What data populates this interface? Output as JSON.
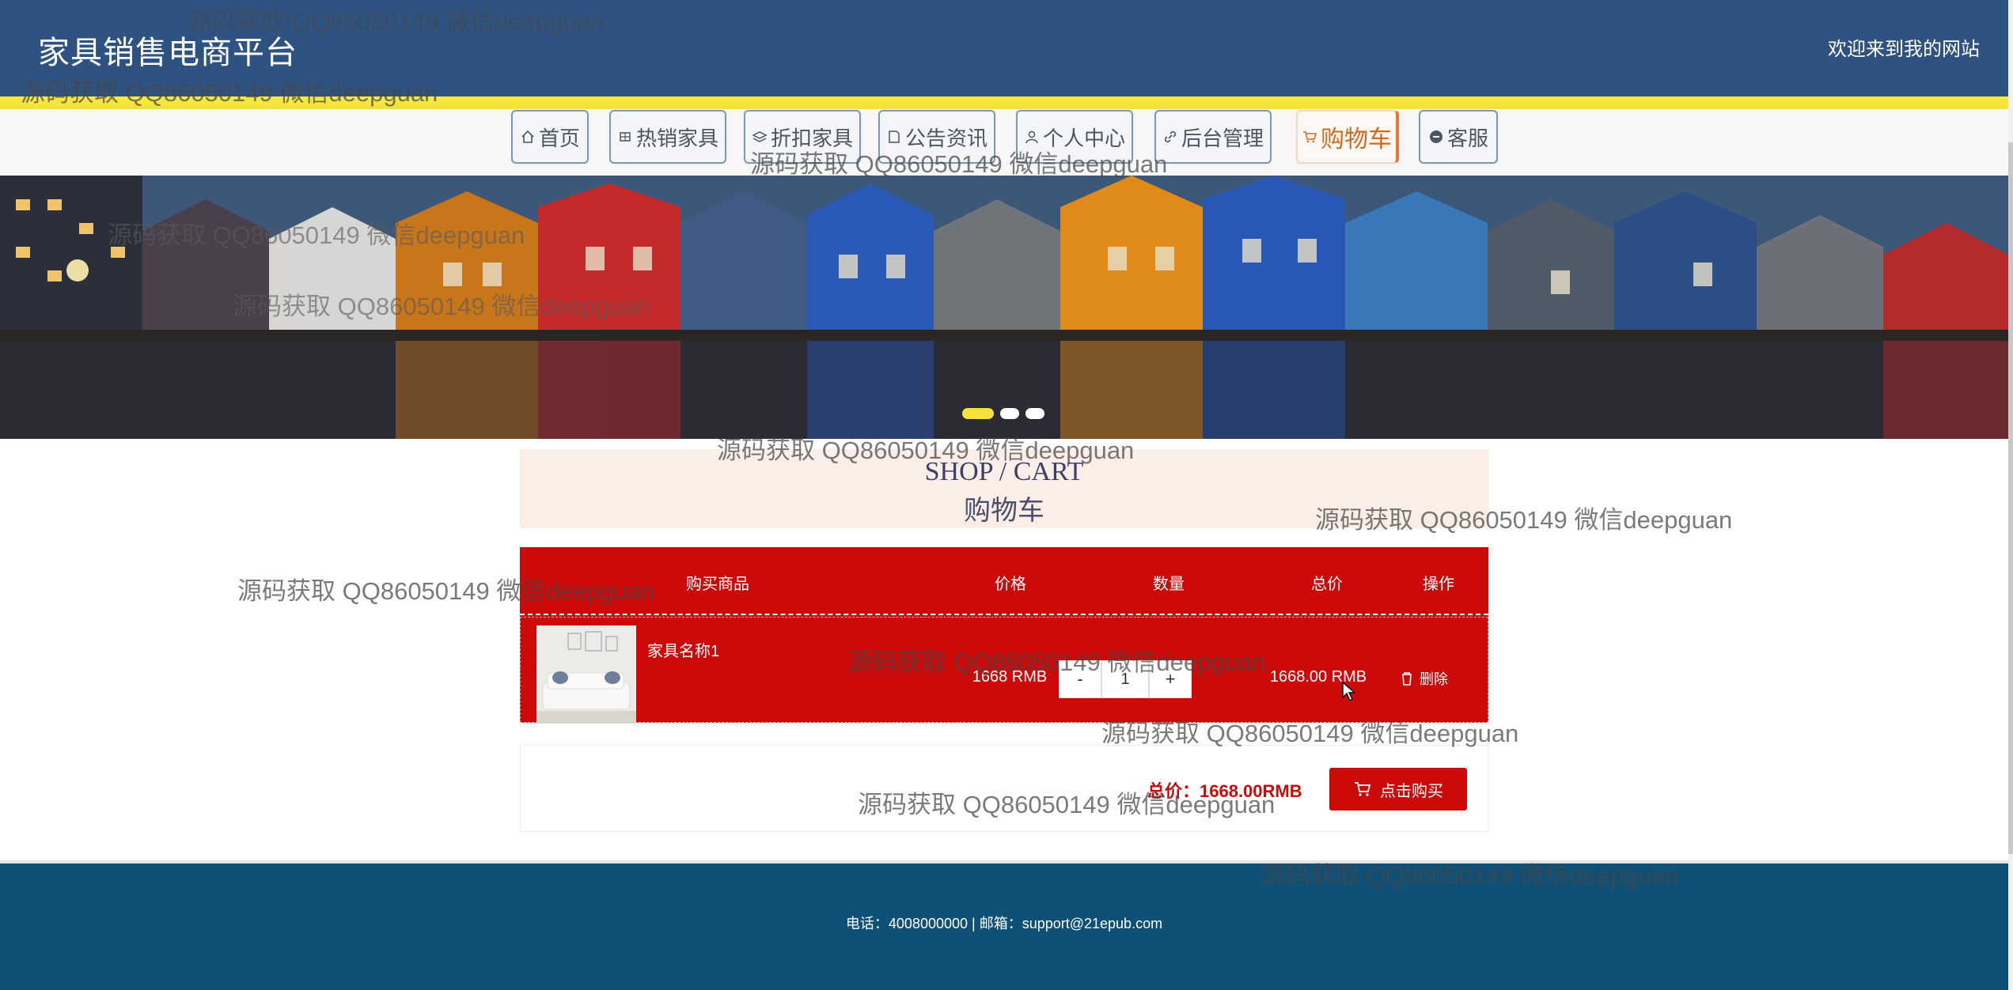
{
  "header": {
    "site_title": "家具销售电商平台",
    "welcome": "欢迎来到我的网站"
  },
  "nav": {
    "items": [
      {
        "label": "首页",
        "icon": "home-icon"
      },
      {
        "label": "热销家具",
        "icon": "grid-icon"
      },
      {
        "label": "折扣家具",
        "icon": "layers-icon"
      },
      {
        "label": "公告资讯",
        "icon": "note-icon"
      },
      {
        "label": "个人中心",
        "icon": "user-icon"
      },
      {
        "label": "后台管理",
        "icon": "link-icon"
      },
      {
        "label": "购物车",
        "icon": "cart-icon",
        "active": true
      },
      {
        "label": "客服",
        "icon": "chat-icon"
      }
    ]
  },
  "banner": {
    "slides": 3,
    "active_slide": 1
  },
  "cart": {
    "heading_en": "SHOP / CART",
    "heading_cn": "购物车",
    "columns": [
      "购买商品",
      "价格",
      "数量",
      "总价",
      "操作"
    ],
    "items": [
      {
        "name": "家具名称1",
        "price": "1668 RMB",
        "quantity": "1",
        "minus": "-",
        "plus": "+",
        "total": "1668.00 RMB",
        "delete_label": "删除"
      }
    ],
    "summary_total": "总价：1668.00RMB",
    "buy_label": "点击购买"
  },
  "footer": {
    "contact": "电话：4008000000 | 邮箱：support@21epub.com"
  },
  "watermark": {
    "text": "源码获取 QQ86050149 微信deepguan"
  },
  "colors": {
    "header_bg": "#2f5381",
    "accent_yellow": "#f5e23c",
    "cart_red": "#cc0a0a",
    "footer_bg": "#0f5077",
    "active_nav": "#d2691e"
  }
}
